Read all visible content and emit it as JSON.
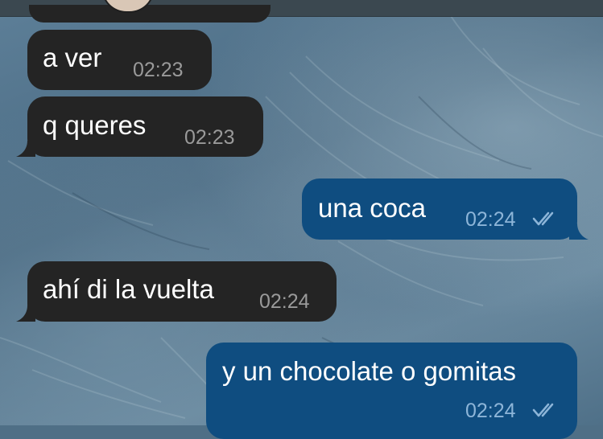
{
  "chat": {
    "messages": [
      {
        "direction": "incoming",
        "text": "a ver",
        "time": "02:23"
      },
      {
        "direction": "incoming",
        "text": "q queres",
        "time": "02:23"
      },
      {
        "direction": "outgoing",
        "text": "una coca",
        "time": "02:24",
        "status_icon": "double-check-icon"
      },
      {
        "direction": "incoming",
        "text": "ahí di la vuelta",
        "time": "02:24"
      },
      {
        "direction": "outgoing",
        "text": "y un chocolate o gomitas",
        "time": "02:24",
        "status_icon": "double-check-icon"
      }
    ]
  },
  "colors": {
    "incoming_bubble": "#242424",
    "outgoing_bubble": "#0f4d80",
    "incoming_time": "#9a9a9a",
    "outgoing_time": "#8db5d8"
  }
}
